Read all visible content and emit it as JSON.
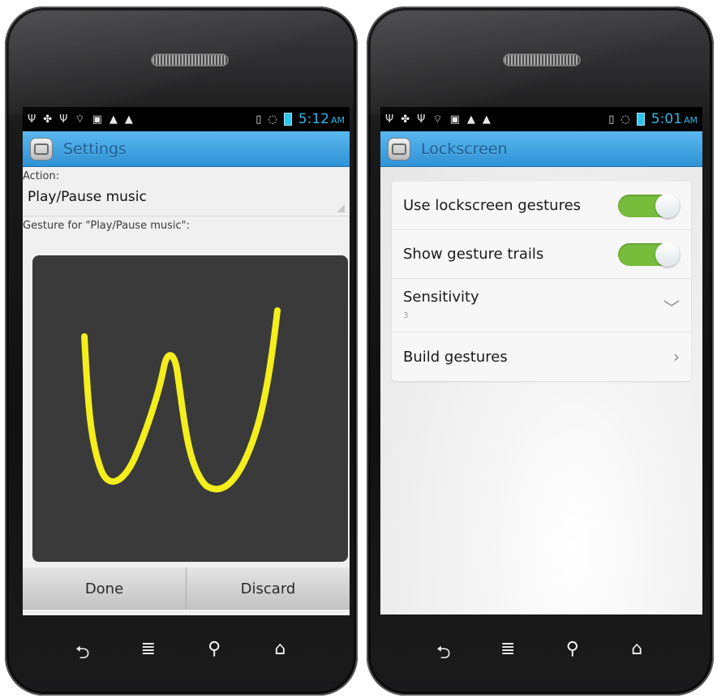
{
  "left": {
    "status_time": "5:12",
    "status_ampm": "AM",
    "title": "Settings",
    "action_label": "Action:",
    "action_value": "Play/Pause music",
    "gesture_label": "Gesture for \"Play/Pause music\":",
    "gesture_stroke_color": "#f4ee1c",
    "done_label": "Done",
    "discard_label": "Discard"
  },
  "right": {
    "status_time": "5:01",
    "status_ampm": "AM",
    "title": "Lockscreen",
    "rows": [
      {
        "label": "Use lockscreen gestures",
        "control": "toggle",
        "on": true
      },
      {
        "label": "Show gesture trails",
        "control": "toggle",
        "on": true
      },
      {
        "label": "Sensitivity",
        "value": "3",
        "control": "chevron-down"
      },
      {
        "label": "Build gestures",
        "control": "chevron-right"
      }
    ]
  },
  "colors": {
    "accent_blue": "#33b5e5",
    "actionbar_blue": "#2f92d6",
    "toggle_green": "#78bc3c"
  },
  "nav_icons": [
    "back-icon",
    "menu-icon",
    "search-icon",
    "home-icon"
  ]
}
